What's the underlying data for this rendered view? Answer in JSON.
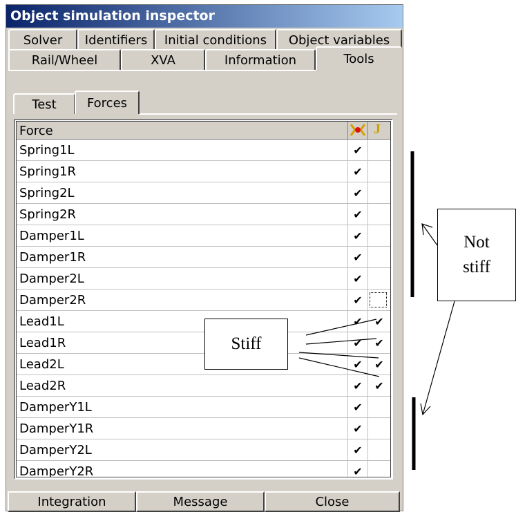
{
  "window": {
    "title": "Object simulation inspector"
  },
  "tabs_row1": [
    "Solver",
    "Identifiers",
    "Initial conditions",
    "Object variables"
  ],
  "tabs_row2": [
    "Rail/Wheel",
    "XVA",
    "Information",
    "Tools"
  ],
  "subtabs": [
    "Test",
    "Forces"
  ],
  "active_subtab": "Forces",
  "grid": {
    "header": "Force",
    "col1_icon": "stiff-solver-icon",
    "col2_icon": "jacobian-J-icon",
    "col2_label": "J",
    "rows": [
      {
        "name": "Spring1L",
        "c1": "✔",
        "c2": ""
      },
      {
        "name": "Spring1R",
        "c1": "✔",
        "c2": ""
      },
      {
        "name": "Spring2L",
        "c1": "✔",
        "c2": ""
      },
      {
        "name": "Spring2R",
        "c1": "✔",
        "c2": ""
      },
      {
        "name": "Damper1L",
        "c1": "✔",
        "c2": ""
      },
      {
        "name": "Damper1R",
        "c1": "✔",
        "c2": ""
      },
      {
        "name": "Damper2L",
        "c1": "✔",
        "c2": ""
      },
      {
        "name": "Damper2R",
        "c1": "✔",
        "c2": ""
      },
      {
        "name": "Lead1L",
        "c1": "✔",
        "c2": "✔"
      },
      {
        "name": "Lead1R",
        "c1": "✔",
        "c2": "✔"
      },
      {
        "name": "Lead2L",
        "c1": "✔",
        "c2": "✔"
      },
      {
        "name": "Lead2R",
        "c1": "✔",
        "c2": "✔"
      },
      {
        "name": "DamperY1L",
        "c1": "✔",
        "c2": ""
      },
      {
        "name": "DamperY1R",
        "c1": "✔",
        "c2": ""
      },
      {
        "name": "DamperY2L",
        "c1": "✔",
        "c2": ""
      },
      {
        "name": "DamperY2R",
        "c1": "✔",
        "c2": ""
      }
    ]
  },
  "buttons": [
    "Integration",
    "Message",
    "Close"
  ],
  "annotations": {
    "stiff": "Stiff",
    "not_stiff_line1": "Not",
    "not_stiff_line2": "stiff"
  },
  "colors": {
    "titlebar_start": "#0a246a",
    "titlebar_end": "#a6caf0",
    "face": "#d4d0c8"
  }
}
